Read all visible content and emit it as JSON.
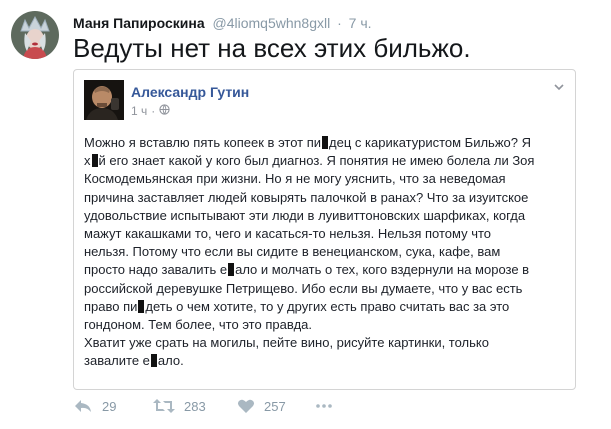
{
  "tweet": {
    "author_name": "Маня Папироскина",
    "author_handle": "@4liomq5whn8gxll",
    "separator": "·",
    "time": "7 ч.",
    "text": "Ведуты нет на всех этих бильжо."
  },
  "embedded_post": {
    "author_name": "Александр Гутин",
    "time": "1 ч",
    "lines": [
      [
        "Можно я вставлю пять копеек в этот пи",
        "дец с карикатуристом Бильжо? Я"
      ],
      [
        "х",
        "й его знает какой у кого был диагноз. Я понятия не имею болела ли Зоя"
      ],
      [
        "Космодемьянская при жизни. Но я не могу уяснить, что за неведомая"
      ],
      [
        "причина заставляет людей ковырять палочкой в ранах? Что за изуитское"
      ],
      [
        "удовольствие испытывают эти люди в луивиттоновских шарфиках, когда"
      ],
      [
        "мажут какашками то, чего и касаться-то нельзя. Нельзя потому что"
      ],
      [
        "нельзя. Потому что если вы сидите в венецианском, сука, кафе, вам"
      ],
      [
        "просто надо завалить е",
        "ало и молчать о тех, кого вздернули на морозе в"
      ],
      [
        "российской деревушке Петрищево. Ибо если вы думаете, что у вас есть"
      ],
      [
        "право пи",
        "деть о чем хотите, то у других есть право считать вас за это"
      ],
      [
        "гондоном. Тем более, что это правда."
      ],
      [
        "Хватит уже срать на могилы, пейте вино, рисуйте картинки, только"
      ],
      [
        "завалите е",
        "ало."
      ]
    ]
  },
  "actions": {
    "reply_count": "29",
    "retweet_count": "283",
    "like_count": "257"
  },
  "icons": {
    "reply": "reply-icon",
    "retweet": "retweet-icon",
    "like": "heart-icon",
    "more": "more-icon",
    "globe": "globe-icon",
    "chevron": "chevron-down-icon"
  },
  "colors": {
    "link_blue": "#365899",
    "muted_gray": "#8899a6"
  }
}
